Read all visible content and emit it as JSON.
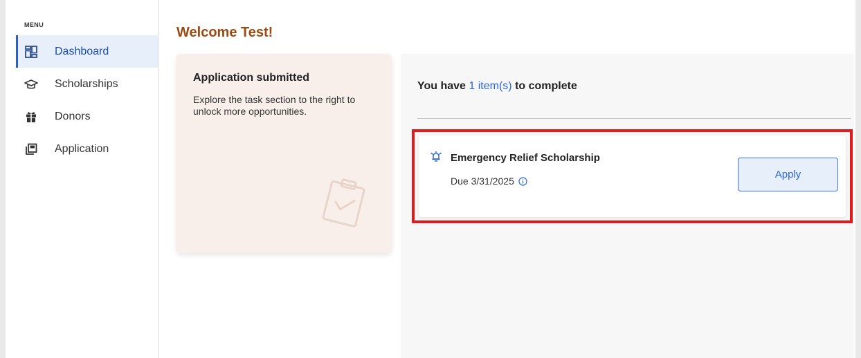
{
  "sidebar": {
    "menu_header": "MENU",
    "items": [
      {
        "label": "Dashboard",
        "icon": "dashboard-icon",
        "active": true
      },
      {
        "label": "Scholarships",
        "icon": "graduation-cap-icon",
        "active": false
      },
      {
        "label": "Donors",
        "icon": "gift-icon",
        "active": false
      },
      {
        "label": "Application",
        "icon": "application-icon",
        "active": false
      }
    ]
  },
  "header": {
    "title": "Welcome Test!"
  },
  "status_card": {
    "title": "Application submitted",
    "body": "Explore the task section to the right to unlock more opportunities.",
    "icon": "clipboard-check-icon"
  },
  "tasks": {
    "heading_prefix": "You have ",
    "heading_count": "1 item(s)",
    "heading_suffix": " to complete",
    "items": [
      {
        "title": "Emergency Relief Scholarship",
        "due": "Due 3/31/2025",
        "action_label": "Apply",
        "icon": "alarm-bell-icon"
      }
    ]
  },
  "colors": {
    "accent": "#2c66d6",
    "title": "#9b4a12",
    "highlight": "#e11b1b",
    "card_bg": "#f8efeb"
  }
}
